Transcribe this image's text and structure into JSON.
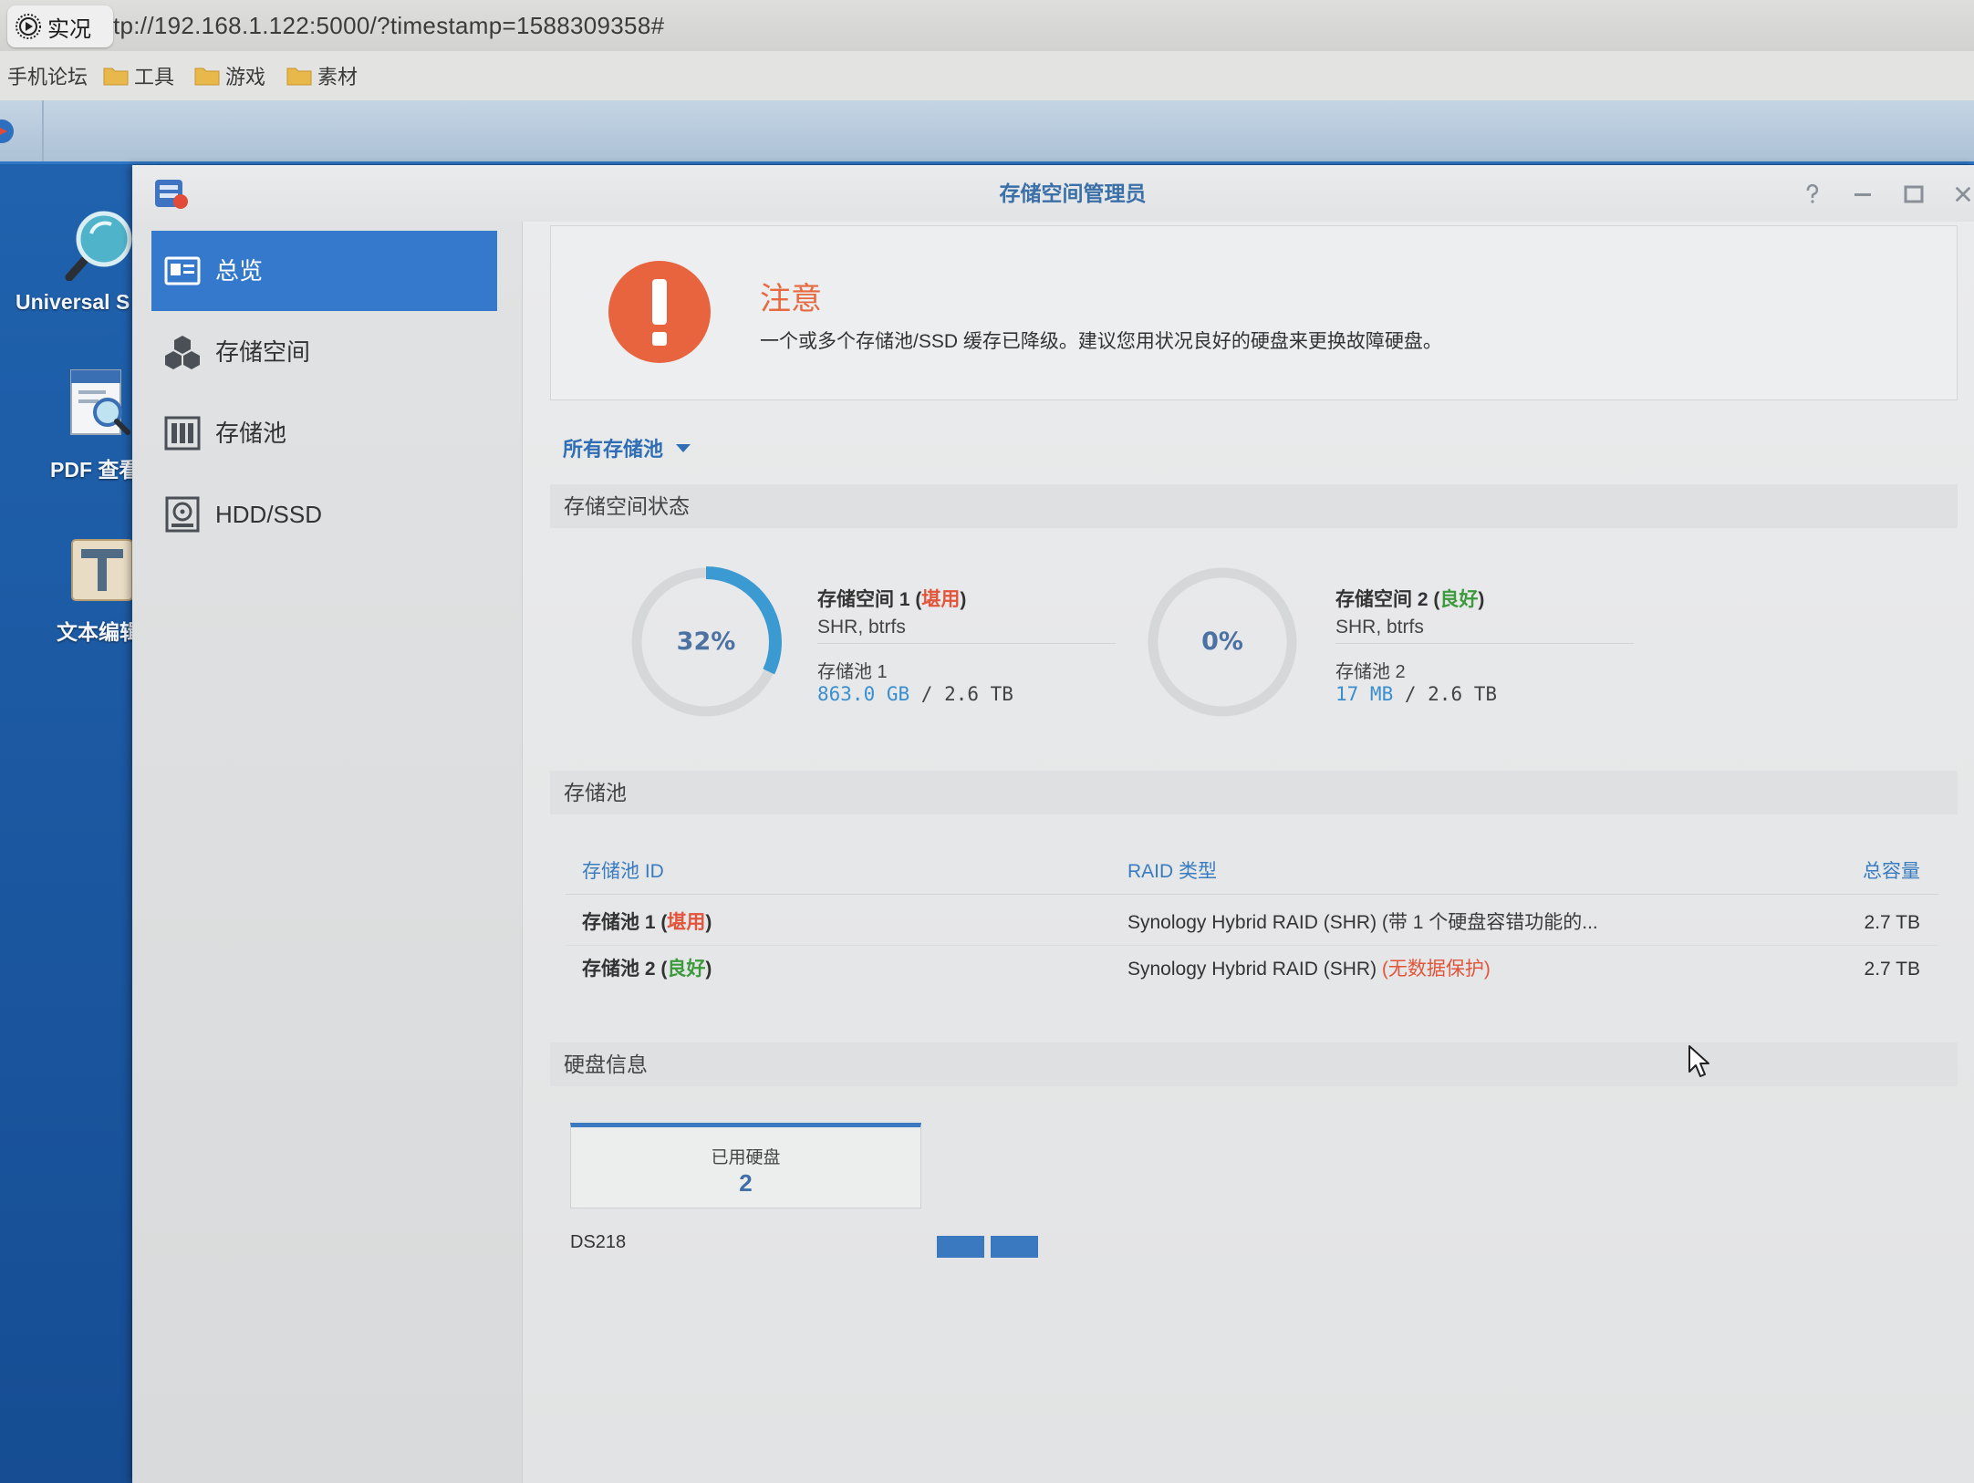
{
  "browser": {
    "live_badge": "实况",
    "live_badge_icon": "live-photo-icon",
    "url": "tp://192.168.1.122:5000/?timestamp=1588309358#",
    "bookmarks": [
      {
        "label": "手机论坛"
      },
      {
        "label": "工具",
        "icon": "folder-icon"
      },
      {
        "label": "游戏",
        "icon": "folder-icon"
      },
      {
        "label": "素材",
        "icon": "folder-icon"
      }
    ]
  },
  "taskbar": {
    "main_menu_icon": "dsm-main-menu-icon"
  },
  "desktop": {
    "icons": [
      {
        "label": "Universal S",
        "icon": "universal-search-icon"
      },
      {
        "label": "PDF 查看",
        "icon": "pdf-viewer-icon"
      },
      {
        "label": "文本编辑",
        "icon": "text-editor-icon"
      }
    ]
  },
  "window": {
    "title": "存储空间管理员",
    "app_icon": "storage-manager-icon",
    "controls": [
      "help-icon",
      "minimize-icon",
      "maximize-icon",
      "close-icon"
    ]
  },
  "sidebar": {
    "items": [
      {
        "label": "总览",
        "icon": "overview-icon",
        "selected": true
      },
      {
        "label": "存储空间",
        "icon": "volume-icon",
        "selected": false
      },
      {
        "label": "存储池",
        "icon": "storage-pool-icon",
        "selected": false
      },
      {
        "label": "HDD/SSD",
        "icon": "hdd-ssd-icon",
        "selected": false
      }
    ]
  },
  "alert": {
    "icon": "warning-icon",
    "title": "注意",
    "message": "一个或多个存储池/SSD 缓存已降级。建议您用状况良好的硬盘来更换故障硬盘。"
  },
  "filter": {
    "label": "所有存储池",
    "icon": "chevron-down-icon"
  },
  "volume_status": {
    "header": "存储空间状态",
    "volumes": [
      {
        "name": "存储空间 1 ",
        "open": "(",
        "status": "堪用",
        "close": ")",
        "status_color": "#e2553b",
        "fs": "SHR, btrfs",
        "pool": "存储池 1",
        "used": "863.0 GB",
        "separator": " / ",
        "total": "2.6 TB",
        "percent_label": "32%",
        "usage_fraction": 0.32
      },
      {
        "name": "存储空间 2 ",
        "open": "(",
        "status": "良好",
        "close": ")",
        "status_color": "#3d9a3c",
        "fs": "SHR, btrfs",
        "pool": "存储池 2",
        "used": "17 MB",
        "separator": " / ",
        "total": "2.6 TB",
        "percent_label": "0%",
        "usage_fraction": 0.0
      }
    ]
  },
  "storage_pools": {
    "header": "存储池",
    "columns": {
      "id": "存储池 ID",
      "raid": "RAID 类型",
      "capacity": "总容量"
    },
    "rows": [
      {
        "name": "存储池 1 ",
        "open": "(",
        "status": "堪用",
        "close": ")",
        "status_color": "#e2553b",
        "raid": "Synology Hybrid RAID (SHR) ",
        "raid_note": "(带 1 个硬盘容错功能的...",
        "raid_note_color": "#3a3a3a",
        "capacity": "2.7 TB"
      },
      {
        "name": "存储池 2 ",
        "open": "(",
        "status": "良好",
        "close": ")",
        "status_color": "#3d9a3c",
        "raid": "Synology Hybrid RAID (SHR) ",
        "raid_note": "(无数据保护)",
        "raid_note_color": "#e2553b",
        "capacity": "2.7 TB"
      }
    ]
  },
  "disk_info": {
    "header": "硬盘信息",
    "used_label": "已用硬盘",
    "used_count": "2",
    "model": "DS218",
    "bays": 2
  },
  "colors": {
    "accent": "#3479cc",
    "warning": "#e8693f",
    "link": "#3a8fcf",
    "usage_arc": "#3c9ad3",
    "desktop": "#2062ae"
  },
  "cursor_icon": "mouse-cursor-icon"
}
